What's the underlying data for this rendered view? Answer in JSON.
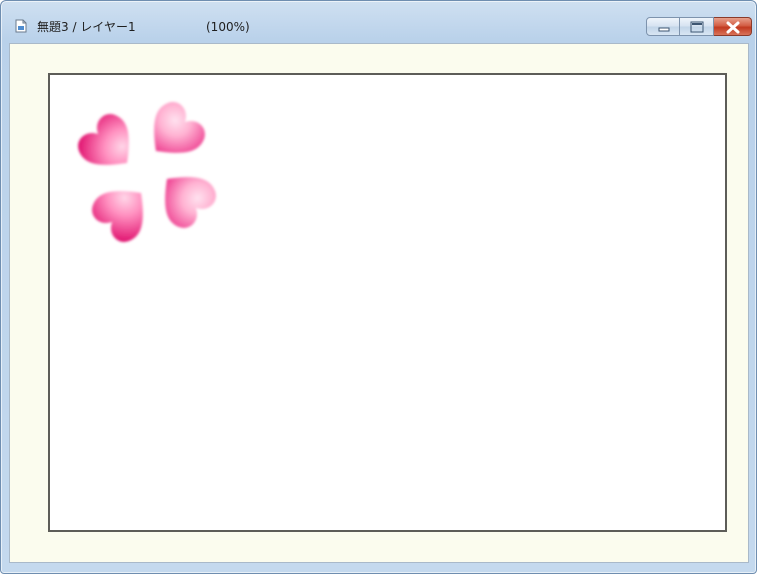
{
  "window": {
    "title": "無題3 / レイヤー1",
    "zoom": "(100%)"
  },
  "icons": {
    "app": "document-icon",
    "minimize": "minimize-icon",
    "maximize": "maximize-icon",
    "close": "close-icon",
    "canvas_art": "heart-clover-image"
  },
  "colors": {
    "canvas_background": "#ffffff",
    "workspace_background": "#fbfcee",
    "heart_dark": "#e8187a",
    "heart_light": "#ffc6de"
  }
}
